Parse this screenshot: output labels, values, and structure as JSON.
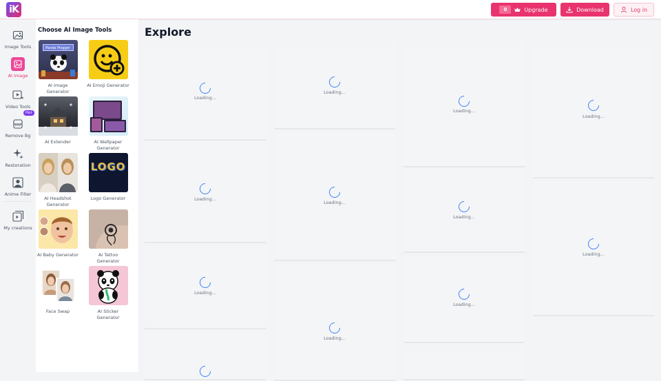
{
  "header": {
    "logo_text": "iK",
    "credits_value": "0",
    "upgrade_label": "Upgrade",
    "download_label": "Download",
    "login_label": "Log in",
    "accent": "#e8336e"
  },
  "rail": {
    "items": [
      {
        "label": "Image Tools",
        "icon": "image-tools-icon"
      },
      {
        "label": "AI Image",
        "icon": "ai-image-icon"
      },
      {
        "label": "Video Tools",
        "icon": "video-tools-icon"
      },
      {
        "label": "Remove Bg",
        "icon": "remove-bg-icon"
      },
      {
        "label": "Restoration",
        "icon": "restoration-icon"
      },
      {
        "label": "Anime Filter",
        "icon": "anime-filter-icon"
      },
      {
        "label": "My creations",
        "icon": "my-creations-icon"
      }
    ],
    "hot_badge": "Hot"
  },
  "panel": {
    "title": "Choose AI Image Tools",
    "thumb_panda_text": "Panda Plogger",
    "thumb_logo_text": "LOGO",
    "tools": [
      {
        "label": "AI Image Generator"
      },
      {
        "label": "AI Emoji Generator"
      },
      {
        "label": "AI Extender"
      },
      {
        "label": "AI Wallpaper Generator"
      },
      {
        "label": "AI Headshot Generator"
      },
      {
        "label": "Logo Generator"
      },
      {
        "label": "AI Baby Generator"
      },
      {
        "label": "AI Tattoo Generator"
      },
      {
        "label": "Face Swap"
      },
      {
        "label": "AI Sticker Generator"
      }
    ]
  },
  "main": {
    "title": "Explore",
    "loading_text": "Loading..."
  }
}
